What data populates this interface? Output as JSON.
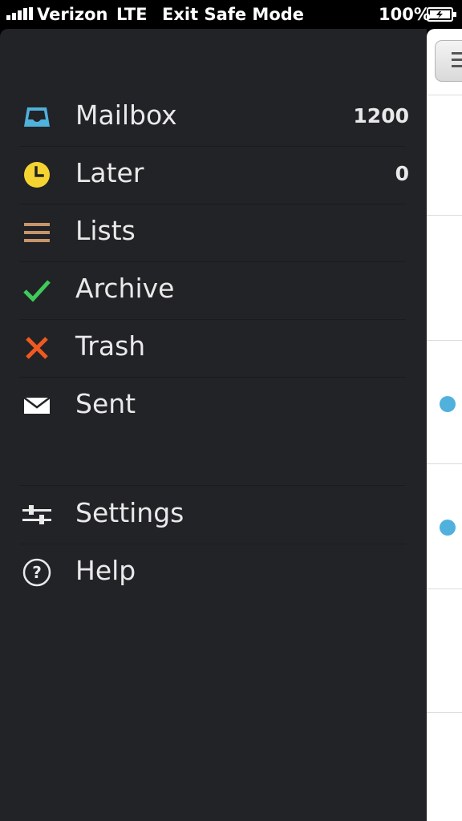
{
  "status_bar": {
    "carrier": "Verizon",
    "network": "LTE",
    "exit_safe_mode": "Exit Safe Mode",
    "battery": "100%"
  },
  "drawer": {
    "items": [
      {
        "label": "Mailbox",
        "count": "1200",
        "icon": "mailbox-icon",
        "color": "#4fb1dc"
      },
      {
        "label": "Later",
        "count": "0",
        "icon": "clock-icon",
        "color": "#f5d432"
      },
      {
        "label": "Lists",
        "count": "",
        "icon": "lists-icon",
        "color": "#c8956a"
      },
      {
        "label": "Archive",
        "count": "",
        "icon": "checkmark-icon",
        "color": "#3fca5a"
      },
      {
        "label": "Trash",
        "count": "",
        "icon": "x-icon",
        "color": "#f0591f"
      },
      {
        "label": "Sent",
        "count": "",
        "icon": "envelope-icon",
        "color": "#ffffff"
      }
    ],
    "secondary_items": [
      {
        "label": "Settings",
        "icon": "sliders-icon"
      },
      {
        "label": "Help",
        "icon": "question-circle-icon"
      }
    ]
  },
  "colors": {
    "drawer_bg": "#222326",
    "unread_dot": "#4fb1dc"
  }
}
